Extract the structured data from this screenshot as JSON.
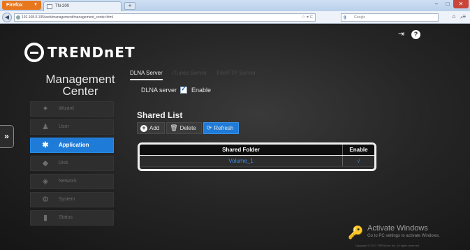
{
  "browser": {
    "app_button": "Firefox",
    "tab_title": "TN-200",
    "new_tab_label": "+",
    "url": "192.168.0.105/web/management/management_center.html",
    "search_placeholder": "Google",
    "search_engine_letter": "g",
    "window_buttons": [
      "–",
      "□",
      "✕"
    ]
  },
  "header": {
    "brand": "TRENDnET",
    "logout_icon": "logout-icon",
    "help_icon": "help-icon"
  },
  "sidebar": {
    "title": "Management Center",
    "items": [
      {
        "label": "Wizard",
        "icon": "wizard-icon",
        "glyph": "✦"
      },
      {
        "label": "User",
        "icon": "user-icon",
        "glyph": "♟"
      },
      {
        "label": "Application",
        "icon": "application-icon",
        "glyph": "✱"
      },
      {
        "label": "Disk",
        "icon": "disk-icon",
        "glyph": "◆"
      },
      {
        "label": "Network",
        "icon": "network-icon",
        "glyph": "◈"
      },
      {
        "label": "System",
        "icon": "system-icon",
        "glyph": "⚙"
      },
      {
        "label": "Status",
        "icon": "status-icon",
        "glyph": "▮"
      }
    ],
    "active_index": 2,
    "expander": "»"
  },
  "tabs": [
    "DLNA Server",
    "iTunes Server",
    "File/FTP Server"
  ],
  "dlna": {
    "label": "DLNA server",
    "checkbox_label": "Enable",
    "enabled": true
  },
  "shared_list": {
    "title": "Shared List",
    "buttons": {
      "add": "Add",
      "delete": "Delete",
      "refresh": "Refresh"
    },
    "columns": [
      "Shared Folder",
      "Enable"
    ],
    "rows": [
      {
        "folder": "Volume_1",
        "enable": "√"
      }
    ]
  },
  "watermark": {
    "title": "Activate Windows",
    "subtitle": "Go to PC settings to activate Windows."
  },
  "copyright": "Copyright © 2013 TRENDnet Inc. All rights reserved.",
  "colors": {
    "accent": "#1f7bd8",
    "background": "#262626",
    "link": "#3d8de8"
  }
}
